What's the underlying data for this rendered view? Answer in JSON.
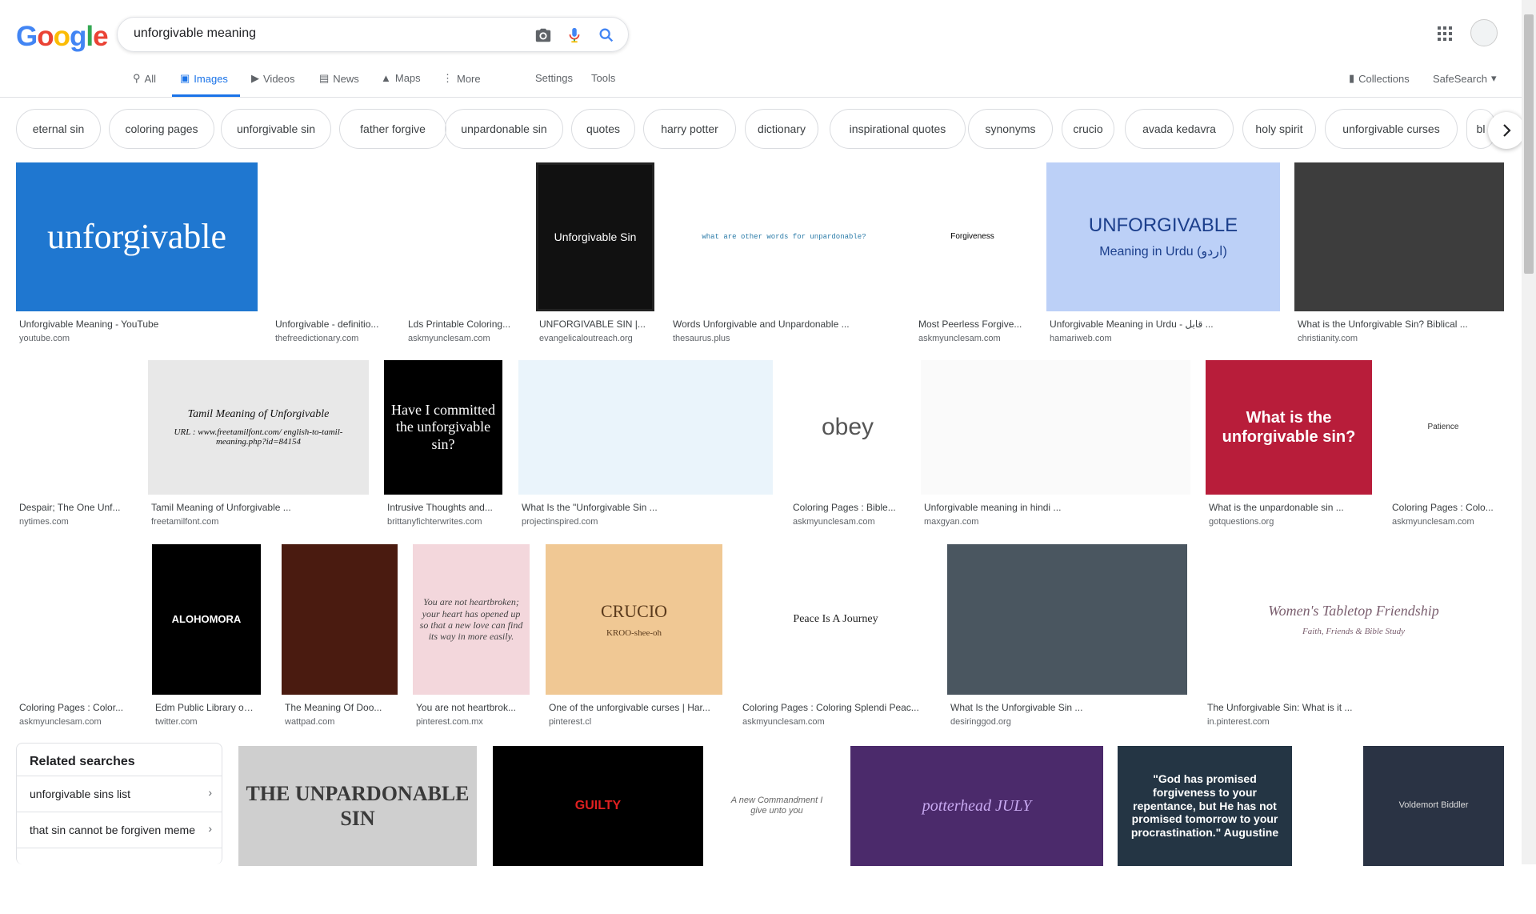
{
  "search": {
    "query": "unforgivable meaning"
  },
  "logo": {
    "letters": [
      {
        "ch": "G",
        "color": "#4285f4"
      },
      {
        "ch": "o",
        "color": "#ea4335"
      },
      {
        "ch": "o",
        "color": "#fbbc05"
      },
      {
        "ch": "g",
        "color": "#4285f4"
      },
      {
        "ch": "l",
        "color": "#34a853"
      },
      {
        "ch": "e",
        "color": "#ea4335"
      }
    ]
  },
  "tabs": {
    "all": "All",
    "images": "Images",
    "videos": "Videos",
    "news": "News",
    "maps": "Maps",
    "more": "More",
    "settings": "Settings",
    "tools": "Tools",
    "collections": "Collections",
    "safesearch": "SafeSearch"
  },
  "chips": [
    "eternal sin",
    "coloring pages",
    "unforgivable sin",
    "father forgive",
    "unpardonable sin",
    "quotes",
    "harry potter",
    "dictionary",
    "inspirational quotes",
    "synonyms",
    "crucio",
    "avada kedavra",
    "holy spirit",
    "unforgivable curses",
    "bl"
  ],
  "results": [
    {
      "caption": "Unforgivable Meaning - YouTube",
      "source": "youtube.com",
      "thumb_text": "unforgivable"
    },
    {
      "caption": "Unforgivable - definitio...",
      "source": "thefreedictionary.com"
    },
    {
      "caption": "Lds Printable Coloring...",
      "source": "askmyunclesam.com"
    },
    {
      "caption": "UNFORGIVABLE SIN |...",
      "source": "evangelicaloutreach.org",
      "thumb_text": "Unforgivable Sin"
    },
    {
      "caption": "Words Unforgivable and Unpardonable ...",
      "source": "thesaurus.plus",
      "thumb_text": "what are other words for unpardonable?"
    },
    {
      "caption": "Most Peerless Forgive...",
      "source": "askmyunclesam.com",
      "thumb_text": "Forgiveness"
    },
    {
      "caption": "Unforgivable Meaning in Urdu - قابل ...",
      "source": "hamariweb.com",
      "thumb_text": "UNFORGIVABLE",
      "thumb_text2": "Meaning in Urdu (اردو)"
    },
    {
      "caption": "What is the Unforgivable Sin? Biblical ...",
      "source": "christianity.com"
    },
    {
      "caption": "Despair; The One Unf...",
      "source": "nytimes.com"
    },
    {
      "caption": "Tamil Meaning of Unforgivable ...",
      "source": "freetamilfont.com",
      "thumb_text": "Tamil Meaning of Unforgivable",
      "thumb_text2": "URL : www.freetamilfont.com/ english-to-tamil-meaning.php?id=84154"
    },
    {
      "caption": "Intrusive Thoughts and...",
      "source": "brittanyfichterwrites.com",
      "thumb_text": "Have I committed the unforgivable sin?"
    },
    {
      "caption": "What Is the \"Unforgivable Sin ...",
      "source": "projectinspired.com"
    },
    {
      "caption": "Coloring Pages : Bible...",
      "source": "askmyunclesam.com",
      "thumb_text": "obey"
    },
    {
      "caption": "Unforgivable meaning in hindi ...",
      "source": "maxgyan.com"
    },
    {
      "caption": "What is the unpardonable sin ...",
      "source": "gotquestions.org",
      "thumb_text": "What is the unforgivable sin?"
    },
    {
      "caption": "Coloring Pages : Colo...",
      "source": "askmyunclesam.com",
      "thumb_text": "Patience"
    },
    {
      "caption": "Coloring Pages : Color...",
      "source": "askmyunclesam.com"
    },
    {
      "caption": "Edm Public Library on ...",
      "source": "twitter.com",
      "thumb_text": "ALOHOMORA"
    },
    {
      "caption": "The Meaning Of Doo...",
      "source": "wattpad.com"
    },
    {
      "caption": "You are not heartbrok...",
      "source": "pinterest.com.mx",
      "thumb_text": "You are not heartbroken; your heart has opened up so that a new love can find its way in more easily."
    },
    {
      "caption": "One of the unforgivable curses | Har...",
      "source": "pinterest.cl",
      "thumb_text": "CRUCIO",
      "thumb_text2": "KROO-shee-oh"
    },
    {
      "caption": "Coloring Pages : Coloring Splendi Peac...",
      "source": "askmyunclesam.com",
      "thumb_text": "Peace Is A Journey"
    },
    {
      "caption": "What Is the Unforgivable Sin ...",
      "source": "desiringgod.org"
    },
    {
      "caption": "The Unforgivable Sin: What is it ...",
      "source": "in.pinterest.com",
      "thumb_text": "Women's Tabletop Friendship",
      "thumb_text2": "Faith, Friends & Bible Study"
    },
    {
      "thumb_text": "THE UNPARDONABLE SIN"
    },
    {
      "thumb_text": "GUILTY"
    },
    {
      "thumb_text": "A new Commandment I give unto you"
    },
    {
      "thumb_text": "potterhead JULY"
    },
    {
      "thumb_text": "\"God has promised forgiveness to your repentance, but He has not promised tomorrow to your procrastination.\" Augustine"
    },
    {
      "thumb_text": "Voldemort Biddler"
    }
  ],
  "related": {
    "title": "Related searches",
    "items": [
      "unforgivable sins list",
      "that sin cannot be forgiven meme"
    ]
  },
  "colors": {
    "accent": "#1a73e8",
    "border": "#dfe1e5"
  }
}
